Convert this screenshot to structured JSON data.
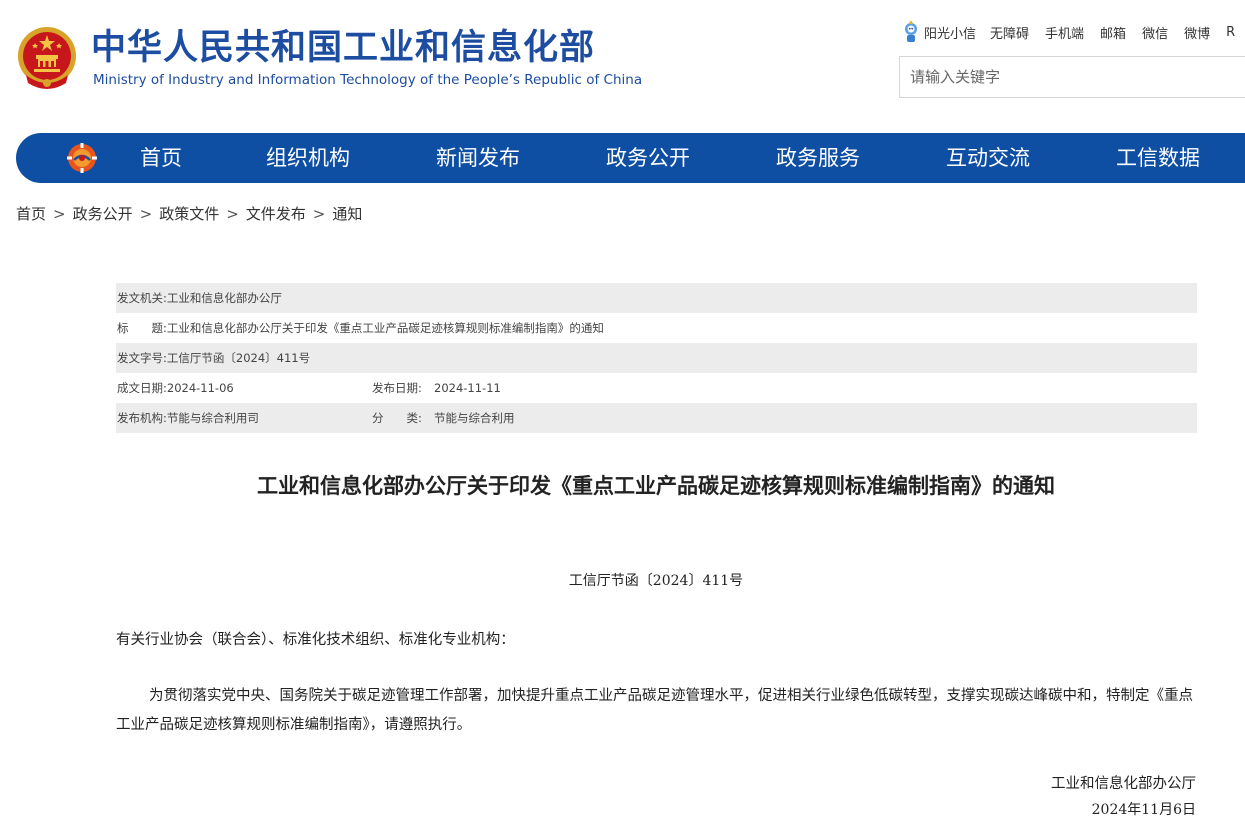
{
  "header": {
    "title_cn": "中华人民共和国工业和信息化部",
    "title_en": "Ministry of Industry and Information Technology of the People’s Republic of China"
  },
  "toplinks": {
    "sunshine": "阳光小信",
    "accessibility": "无障碍",
    "mobile": "手机端",
    "mail": "邮箱",
    "wechat": "微信",
    "weibo": "微博",
    "cut": "R"
  },
  "search": {
    "placeholder": "请输入关键字"
  },
  "nav": [
    {
      "label": "首页"
    },
    {
      "label": "组织机构"
    },
    {
      "label": "新闻发布"
    },
    {
      "label": "政务公开"
    },
    {
      "label": "政务服务"
    },
    {
      "label": "互动交流"
    },
    {
      "label": "工信数据"
    }
  ],
  "breadcrumb": [
    {
      "label": "首页"
    },
    {
      "label": "政务公开"
    },
    {
      "label": "政策文件"
    },
    {
      "label": "文件发布"
    },
    {
      "label": "通知"
    }
  ],
  "breadcrumb_sep": ">",
  "meta": {
    "issuer_label": "发文机关:",
    "issuer": "工业和信息化部办公厅",
    "title_label": "标　　题:",
    "title": "工业和信息化部办公厅关于印发《重点工业产品碳足迹核算规则标准编制指南》的通知",
    "docno_label": "发文字号:",
    "docno": "工信厅节函〔2024〕411号",
    "written_label": "成文日期:",
    "written": "2024-11-06",
    "published_label": "发布日期:",
    "published": "2024-11-11",
    "org_label": "发布机构:",
    "org": "节能与综合利用司",
    "category_label": "分　　类:",
    "category": "节能与综合利用"
  },
  "document": {
    "title": "工业和信息化部办公厅关于印发《重点工业产品碳足迹核算规则标准编制指南》的通知",
    "docno": "工信厅节函〔2024〕411号",
    "addressee": "有关行业协会（联合会）、标准化技术组织、标准化专业机构：",
    "body": "为贯彻落实党中央、国务院关于碳足迹管理工作部署，加快提升重点工业产品碳足迹管理水平，促进相关行业绿色低碳转型，支撑实现碳达峰碳中和，特制定《重点工业产品碳足迹核算规则标准编制指南》，请遵照执行。",
    "signer": "工业和信息化部办公厅",
    "date": "2024年11月6日"
  },
  "colors": {
    "brand": "#1d4da1",
    "nav_bg": "#0e4fa3",
    "meta_stripe": "#ececec"
  }
}
